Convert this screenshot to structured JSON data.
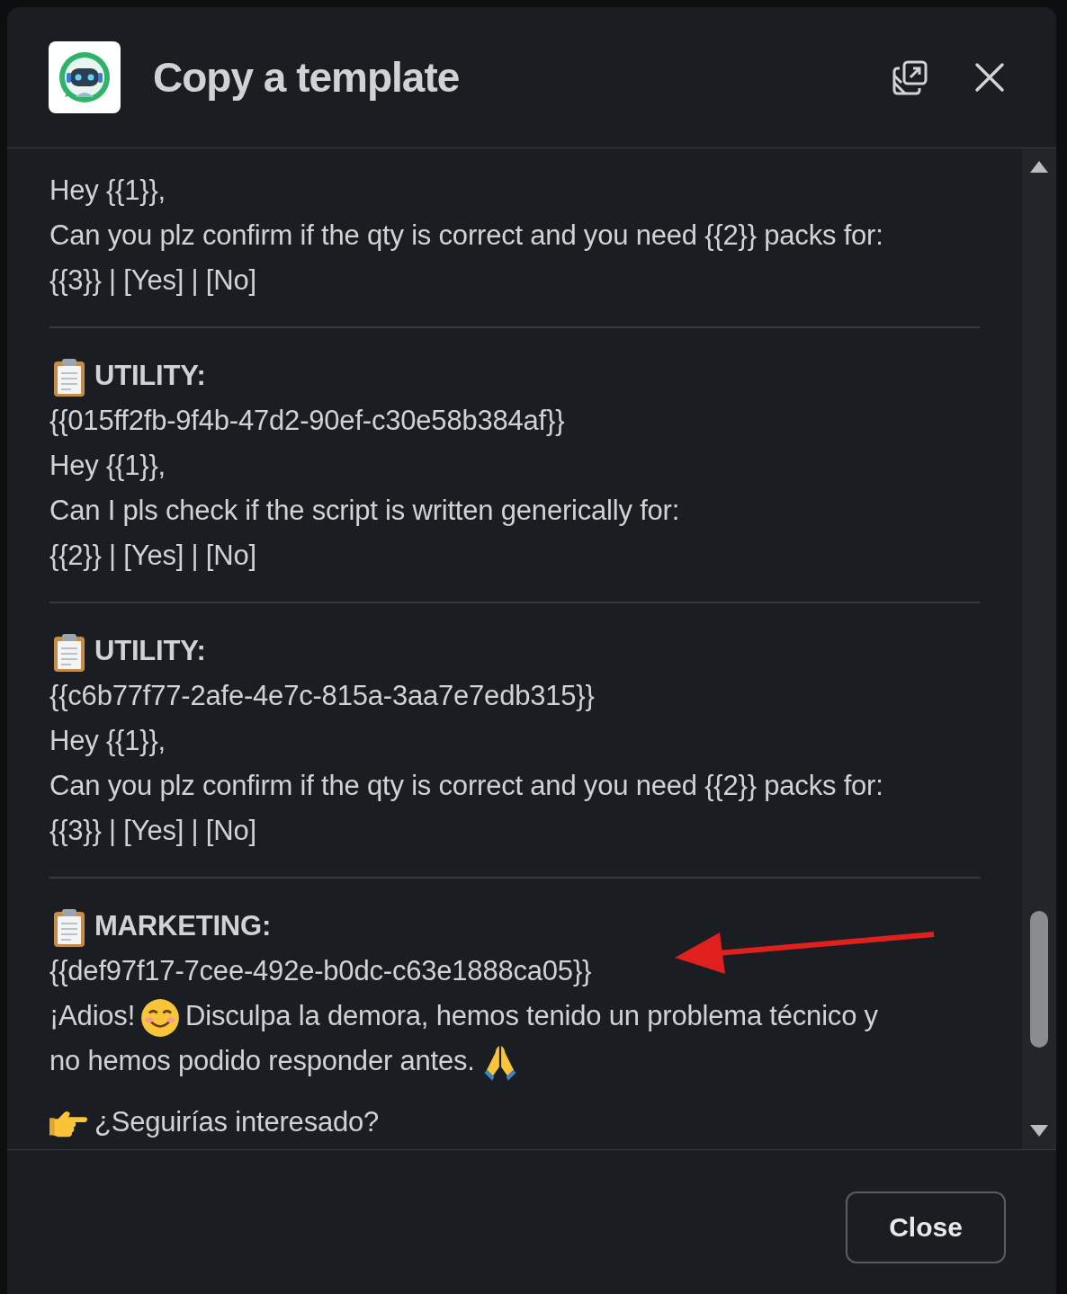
{
  "dialog": {
    "title": "Copy a template",
    "close_button": "Close"
  },
  "templates": [
    {
      "lines": [
        [
          {
            "kind": "text",
            "text": "Hey {{1}},"
          }
        ],
        [
          {
            "kind": "text",
            "text": "Can you plz confirm if the qty is correct and you need {{2}} packs for:"
          }
        ],
        [
          {
            "kind": "text",
            "text": "{{3}} | [Yes] | [No]"
          }
        ]
      ]
    },
    {
      "heading": "UTILITY:",
      "lines": [
        [
          {
            "kind": "text",
            "text": "{{015ff2fb-9f4b-47d2-90ef-c30e58b384af}}"
          }
        ],
        [
          {
            "kind": "text",
            "text": "Hey {{1}},"
          }
        ],
        [
          {
            "kind": "text",
            "text": "Can I pls check if the script is written generically for:"
          }
        ],
        [
          {
            "kind": "text",
            "text": "{{2}} | [Yes] | [No]"
          }
        ]
      ]
    },
    {
      "heading": "UTILITY:",
      "lines": [
        [
          {
            "kind": "text",
            "text": "{{c6b77f77-2afe-4e7c-815a-3aa7e7edb315}}"
          }
        ],
        [
          {
            "kind": "text",
            "text": "Hey {{1}},"
          }
        ],
        [
          {
            "kind": "text",
            "text": "Can you plz confirm if the qty is correct and you need {{2}} packs for:"
          }
        ],
        [
          {
            "kind": "text",
            "text": "{{3}} | [Yes] | [No]"
          }
        ]
      ]
    },
    {
      "heading": "MARKETING:",
      "lines": [
        [
          {
            "kind": "text",
            "text": "{{def97f17-7cee-492e-b0dc-c63e1888ca05}}"
          }
        ],
        [
          {
            "kind": "text",
            "text": "¡Adios!"
          },
          {
            "kind": "smile"
          },
          {
            "kind": "text",
            "text": "Disculpa la demora, hemos tenido un problema técnico y"
          }
        ],
        [
          {
            "kind": "text",
            "text": "no hemos podido responder antes."
          },
          {
            "kind": "pray"
          }
        ],
        [
          {
            "kind": "point"
          },
          {
            "kind": "text",
            "text": "¿Seguirías interesado?"
          }
        ]
      ]
    }
  ]
}
